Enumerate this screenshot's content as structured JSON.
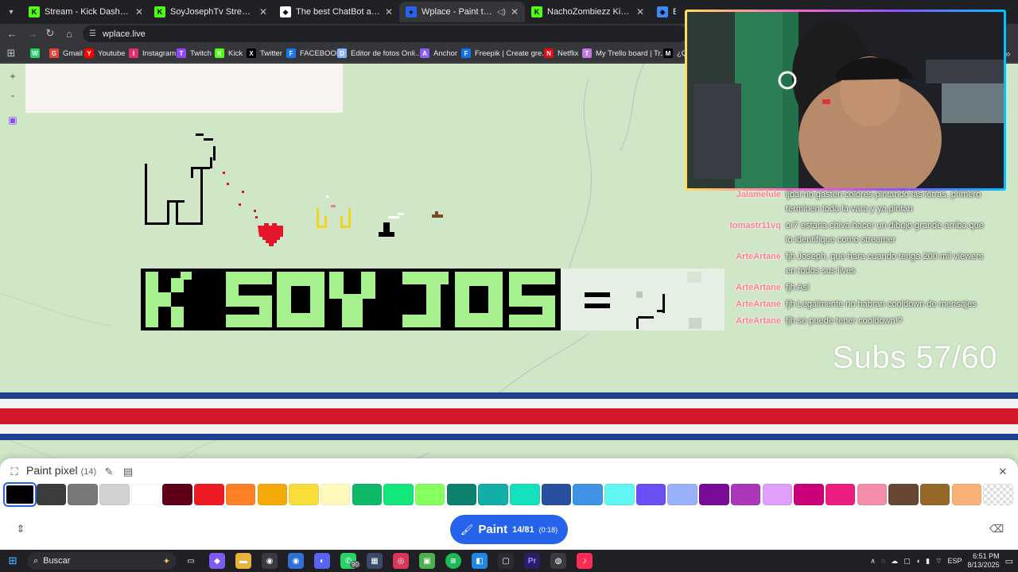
{
  "browser": {
    "tabs": [
      {
        "title": "Stream - Kick Dashboard",
        "favicon": "kick-icon",
        "color": "#53fc18",
        "active": false
      },
      {
        "title": "SoyJosephTv Stream - Watch Li",
        "favicon": "kick-icon",
        "color": "#53fc18",
        "active": false
      },
      {
        "title": "The best ChatBot and Widgets",
        "favicon": "diamond-icon",
        "color": "#ffffff",
        "active": false
      },
      {
        "title": "Wplace - Paint the world",
        "favicon": "globe-icon",
        "color": "#2563eb",
        "active": true
      },
      {
        "title": "NachoZombiezz Kick Font by N",
        "favicon": "kick-icon",
        "color": "#53fc18",
        "active": false
      },
      {
        "title": "Editor",
        "favicon": "edit-icon",
        "color": "#4285f4",
        "active": false
      }
    ],
    "url": "wplace.live",
    "bookmarks": [
      {
        "label": "",
        "icon": "whatsapp-icon",
        "color": "#25d366"
      },
      {
        "label": "Gmail",
        "icon": "gmail-icon",
        "color": "#ea4335"
      },
      {
        "label": "Youtube",
        "icon": "youtube-icon",
        "color": "#ff0000"
      },
      {
        "label": "Instagram",
        "icon": "instagram-icon",
        "color": "#e1306c"
      },
      {
        "label": "Twitch",
        "icon": "twitch-icon",
        "color": "#9146ff"
      },
      {
        "label": "Kick",
        "icon": "kick-icon",
        "color": "#53fc18"
      },
      {
        "label": "Twitter",
        "icon": "x-icon",
        "color": "#000000"
      },
      {
        "label": "FACEBOOK",
        "icon": "facebook-icon",
        "color": "#1877f2"
      },
      {
        "label": "Editor de fotos Onli...",
        "icon": "diamond-icon",
        "color": "#8ab4f8"
      },
      {
        "label": "Anchor",
        "icon": "anchor-icon",
        "color": "#8b5cf6"
      },
      {
        "label": "Freepik | Create gre...",
        "icon": "freepik-icon",
        "color": "#1273eb"
      },
      {
        "label": "Netflix",
        "icon": "netflix-icon",
        "color": "#e50914"
      },
      {
        "label": "My Trello board | Tr...",
        "icon": "trello-icon",
        "color": "#c377e0"
      },
      {
        "label": "¿Qu",
        "icon": "m-icon",
        "color": "#000000"
      }
    ]
  },
  "map": {
    "zoom_in": "+",
    "zoom_out": "-"
  },
  "overlay": {
    "chat": [
      {
        "user": "Jalamelule",
        "message": "ijbai no gasten colores pintando las letras, primero terminen toda la vara y ya pintan"
      },
      {
        "user": "tomastr11vq",
        "message": "or7 estaria chiva hacer un dibujo grande arriba que lo identifique como streamer"
      },
      {
        "user": "ArteArtane",
        "message": "fjh Joseph, que hara cuando tenga 200 mil viewers en todos sus lives"
      },
      {
        "user": "ArteArtane",
        "message": "fjh Asi"
      },
      {
        "user": "ArteArtane",
        "message": "fjh Legalmente no habran cooldown de mensajes"
      },
      {
        "user": "ArteArtane",
        "message": "fjh se puede tener cooldown!?"
      }
    ],
    "subs": "Subs 57/60",
    "stripe_colors": {
      "blue": "#1f3f8f",
      "white": "#ffffff",
      "red": "#d5182b"
    }
  },
  "paint_panel": {
    "title": "Paint pixel",
    "count": "(14)",
    "palette": [
      "#000000",
      "#3c3c3c",
      "#787878",
      "#d2d2d2",
      "#ffffff",
      "#600018",
      "#ed1c24",
      "#ff7f27",
      "#f6aa09",
      "#f9dd3b",
      "#fffabc",
      "#0eb968",
      "#13e67b",
      "#87ff5e",
      "#0c816e",
      "#10aea6",
      "#13e1be",
      "#28509e",
      "#4093e4",
      "#60f7f2",
      "#6b50f6",
      "#99b1fb",
      "#780c99",
      "#aa38b9",
      "#e09ff9",
      "#cb007a",
      "#ec1f80",
      "#f38da9",
      "#684634",
      "#95682a",
      "#f8b277",
      "transparent"
    ],
    "selected_index": 0,
    "paint_button": {
      "label": "Paint",
      "charges": "14/81",
      "cooldown": "(0:18)"
    }
  },
  "taskbar": {
    "search_placeholder": "Buscar",
    "whatsapp_badge": "90",
    "lang": "ESP",
    "time": "6:51 PM",
    "date": "8/13/2025"
  }
}
